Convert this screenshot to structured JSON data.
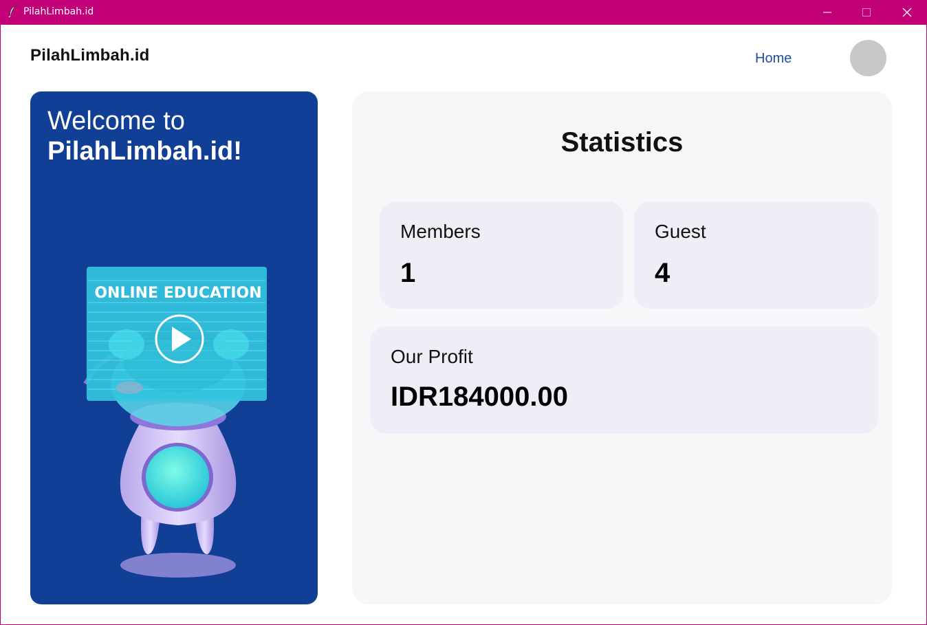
{
  "window": {
    "title": "PilahLimbah.id"
  },
  "header": {
    "brand": "PilahLimbah.id",
    "nav_home": "Home"
  },
  "welcome": {
    "line1": "Welcome to",
    "line2": "PilahLimbah.id!",
    "illustration_text": "ONLINE EDUCATION"
  },
  "stats": {
    "title": "Statistics",
    "members_label": "Members",
    "members_value": "1",
    "guest_label": "Guest",
    "guest_value": "4",
    "profit_label": "Our Profit",
    "profit_value": "IDR184000.00"
  },
  "colors": {
    "titlebar": "#c20077",
    "card_blue": "#123f96",
    "link": "#1e4fa3",
    "panel_bg": "#f7f7fa",
    "stat_card_bg": "#f1edf7"
  },
  "icons": [
    "feather-icon",
    "minimize-icon",
    "maximize-icon",
    "close-icon",
    "play-icon"
  ]
}
